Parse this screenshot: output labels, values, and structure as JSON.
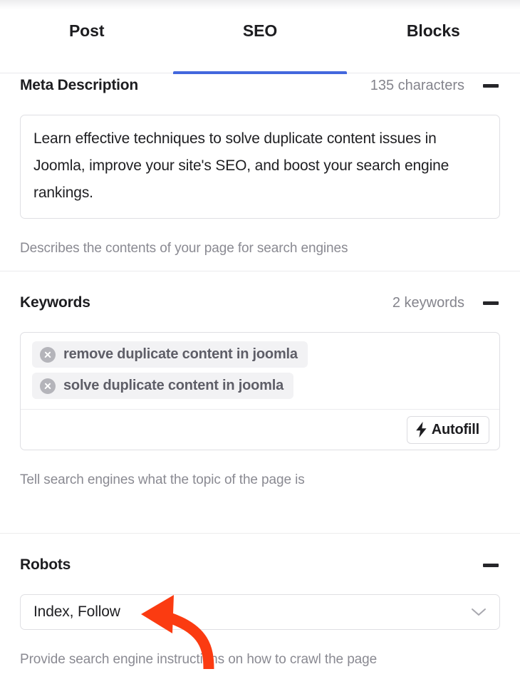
{
  "tabs": [
    {
      "label": "Post",
      "active": false
    },
    {
      "label": "SEO",
      "active": true
    },
    {
      "label": "Blocks",
      "active": false
    }
  ],
  "accent_color": "#4267dd",
  "annotation": {
    "type": "curved-arrow",
    "color": "#fb3b11",
    "points_to": "robots-select",
    "direction": "left"
  },
  "meta_description": {
    "title": "Meta Description",
    "count_label": "135 characters",
    "collapse_icon": "minus-icon",
    "value": "Learn effective techniques to solve duplicate content issues in Joomla, improve your site's SEO, and boost your search engine rankings.",
    "placeholder": "Meta description",
    "help": "Describes the contents of your page for search engines"
  },
  "keywords": {
    "title": "Keywords",
    "count_label": "2 keywords",
    "collapse_icon": "minus-icon",
    "chips": [
      {
        "label": "remove duplicate content in joomla",
        "remove_icon": "close-circle-icon"
      },
      {
        "label": "solve duplicate content in joomla",
        "remove_icon": "close-circle-icon"
      }
    ],
    "autofill_label": "Autofill",
    "autofill_icon": "lightning-bolt-icon",
    "help": "Tell search engines what the topic of the page is"
  },
  "robots": {
    "title": "Robots",
    "collapse_icon": "minus-icon",
    "selected": "Index, Follow",
    "dropdown_icon": "chevron-down-icon",
    "help": "Provide search engine instructions on how to crawl the page"
  }
}
